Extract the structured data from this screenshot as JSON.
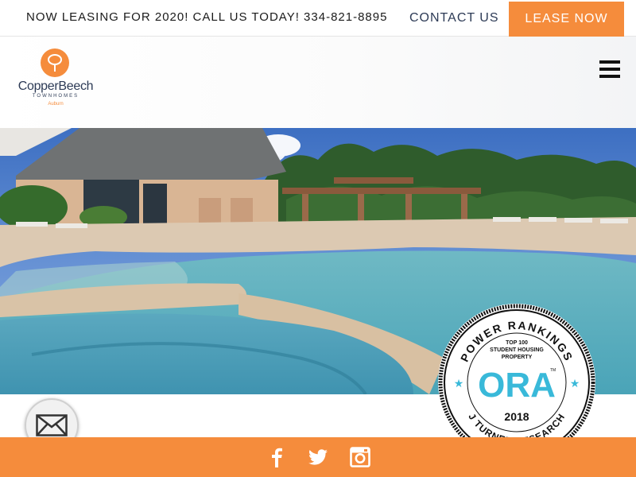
{
  "topbar": {
    "promo": "NOW LEASING FOR 2020! CALL US TODAY! 334-821-8895",
    "contact_label": "CONTACT US",
    "lease_label": "LEASE NOW"
  },
  "header": {
    "logo": {
      "name": "CopperBeech",
      "sub": "TOWNHOMES",
      "location": "Auburn"
    },
    "menu_icon": "hamburger-icon"
  },
  "hero": {
    "scene": "pool-photo"
  },
  "badge": {
    "arc_top": "POWER RANKINGS",
    "line1": "TOP 100",
    "line2": "STUDENT HOUSING",
    "line3": "PROPERTY",
    "brand": "ORA",
    "tm": "TM",
    "year": "2018",
    "arc_bottom": "J TURNER RESEARCH"
  },
  "floating": {
    "mail_icon": "envelope-icon"
  },
  "footer": {
    "icons": [
      "facebook-icon",
      "twitter-icon",
      "instagram-icon"
    ]
  },
  "colors": {
    "accent": "#f58c3c",
    "navy": "#2d3b56",
    "ora": "#39b9d9"
  }
}
